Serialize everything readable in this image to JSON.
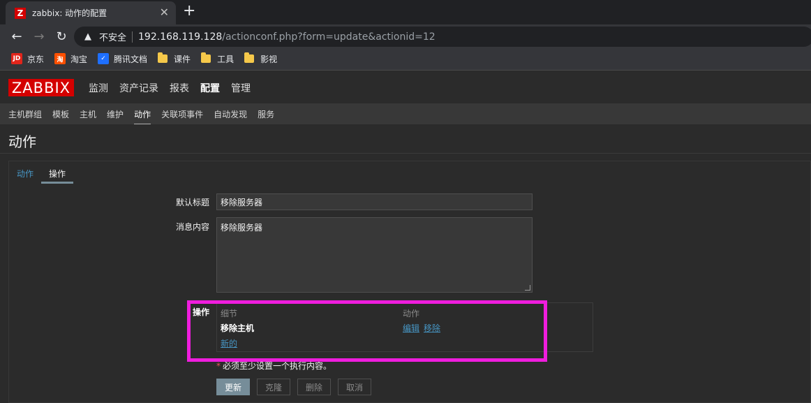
{
  "browser": {
    "tab_title": "zabbix: 动作的配置",
    "tab_favicon": "Z",
    "insecure_label": "不安全",
    "url_host": "192.168.119.128",
    "url_path": "/actionconf.php?form=update&actionid=12",
    "bookmarks": [
      {
        "label": "京东",
        "icon": "JD",
        "color": "#e1251b"
      },
      {
        "label": "淘宝",
        "icon": "淘",
        "color": "#ff5000"
      },
      {
        "label": "腾讯文档",
        "icon": "✓",
        "color": "#1e6fff"
      },
      {
        "label": "课件",
        "icon": "folder"
      },
      {
        "label": "工具",
        "icon": "folder"
      },
      {
        "label": "影视",
        "icon": "folder"
      }
    ]
  },
  "zabbix": {
    "logo": "ZABBIX",
    "main_menu": [
      "监测",
      "资产记录",
      "报表",
      "配置",
      "管理"
    ],
    "main_menu_active": "配置",
    "sub_menu": [
      "主机群组",
      "模板",
      "主机",
      "维护",
      "动作",
      "关联项事件",
      "自动发现",
      "服务"
    ],
    "sub_menu_active": "动作",
    "page_title": "动作",
    "tabs": [
      "动作",
      "操作"
    ],
    "active_tab": "操作",
    "form": {
      "default_subject_label": "默认标题",
      "default_subject_value": "移除服务器",
      "message_label": "消息内容",
      "message_value": "移除服务器",
      "operations_label": "操作",
      "col_details": "细节",
      "col_action": "动作",
      "operation_name": "移除主机",
      "edit_link": "编辑",
      "remove_link": "移除",
      "new_link": "新的",
      "required_note": "必须至少设置一个执行内容。"
    },
    "buttons": {
      "update": "更新",
      "clone": "克隆",
      "delete": "删除",
      "cancel": "取消"
    }
  },
  "colors": {
    "accent_link": "#4796c4",
    "brand_red": "#d40000",
    "highlight_magenta": "#ef1ddd",
    "primary_button": "#768d99"
  }
}
